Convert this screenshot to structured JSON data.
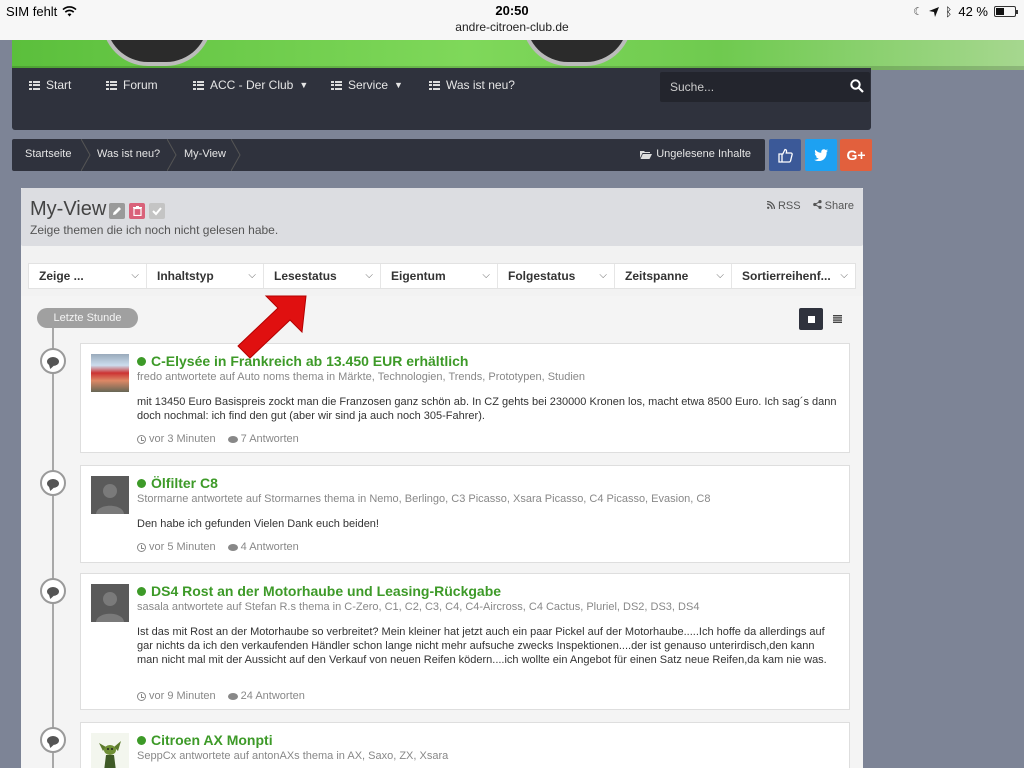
{
  "statusbar": {
    "carrier": "SIM fehlt",
    "time": "20:50",
    "url": "andre-citroen-club.de",
    "battery": "42 %",
    "battery_level": 0.42
  },
  "nav": {
    "items": [
      {
        "label": "Start",
        "dropdown": false
      },
      {
        "label": "Forum",
        "dropdown": false
      },
      {
        "label": "ACC - Der Club",
        "dropdown": true
      },
      {
        "label": "Service",
        "dropdown": true
      },
      {
        "label": "Was ist neu?",
        "dropdown": false
      }
    ],
    "search_placeholder": "Suche..."
  },
  "breadcrumb": {
    "items": [
      "Startseite",
      "Was ist neu?",
      "My-View"
    ],
    "unread_label": "Ungelesene Inhalte"
  },
  "social": {
    "facebook_color": "#3b5998",
    "twitter_color": "#1da1f2",
    "google_color": "#e2603d",
    "google_label": "G+"
  },
  "page": {
    "title": "My-View",
    "subtitle": "Zeige themen die ich noch nicht gelesen habe.",
    "rss_label": "RSS",
    "share_label": "Share"
  },
  "filters": [
    "Zeige ...",
    "Inhaltstyp",
    "Lesestatus",
    "Eigentum",
    "Folgestatus",
    "Zeitspanne",
    "Sortierreihenf..."
  ],
  "timeline": {
    "group_label": "Letzte Stunde"
  },
  "threads": [
    {
      "title": "C-Elysée in Frankreich ab 13.450 EUR erhältlich",
      "meta": "fredo antwortete auf Auto noms thema in Märkte, Technologien, Trends, Prototypen, Studien",
      "body": "mit 13450 Euro Basispreis zockt man die Franzosen ganz schön ab. In CZ gehts bei 230000 Kronen los, macht etwa 8500 Euro. Ich sag´s dann doch nochmal: ich find den gut (aber wir sind ja auch noch 305-Fahrer).",
      "time": "vor 3 Minuten",
      "replies": "7 Antworten",
      "avatar": "car-photo"
    },
    {
      "title": "Ölfilter C8",
      "meta": "Stormarne antwortete auf Stormarnes thema in Nemo, Berlingo, C3 Picasso, Xsara Picasso, C4 Picasso, Evasion, C8",
      "body": "Den habe ich gefunden Vielen Dank euch beiden!",
      "time": "vor 5 Minuten",
      "replies": "4 Antworten",
      "avatar": "default-avatar"
    },
    {
      "title": "DS4 Rost an der Motorhaube und Leasing-Rückgabe",
      "meta": "sasala antwortete auf Stefan R.s thema in C-Zero, C1, C2, C3, C4, C4-Aircross, C4 Cactus, Pluriel, DS2, DS3, DS4",
      "body": "Ist das mit Rost an der Motorhaube so verbreitet? Mein kleiner hat jetzt auch ein paar Pickel auf der Motorhaube.....Ich hoffe da allerdings auf gar nichts da ich den verkaufenden Händler schon lange nicht mehr aufsuche zwecks Inspektionen....der ist genauso unterirdisch,den kann man nicht mal mit der Aussicht auf den Verkauf von neuen Reifen ködern....ich wollte ein Angebot für einen Satz neue Reifen,da kam nie was.",
      "time": "vor 9 Minuten",
      "replies": "24 Antworten",
      "avatar": "default-avatar"
    },
    {
      "title": "Citroen AX Monpti",
      "meta": "SeppCx antwortete auf antonAXs thema in AX, Saxo, ZX, Xsara",
      "body": "",
      "time": "",
      "replies": "",
      "avatar": "character-avatar"
    }
  ],
  "colors": {
    "link_green": "#3d9a28",
    "nav_dark": "#2f323d",
    "background": "#7d8496",
    "annotation_arrow": "#e01010"
  }
}
